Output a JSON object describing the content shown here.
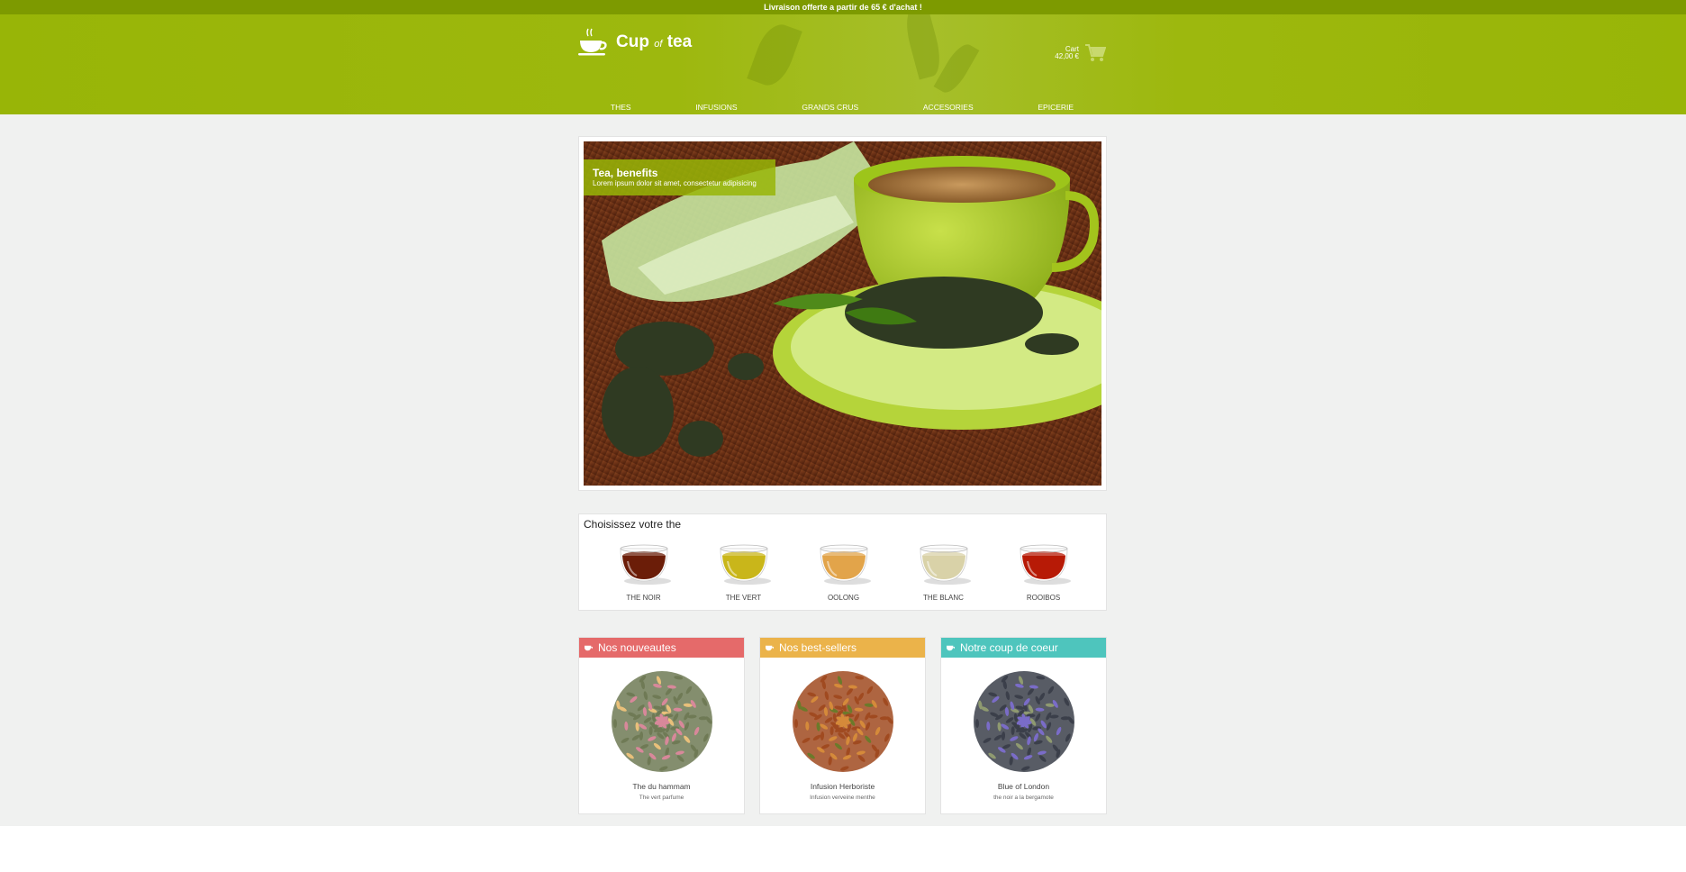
{
  "topbar": {
    "text": "Livraison offerte a partir de 65 € d'achat !"
  },
  "header": {
    "logo": {
      "text_cup": "Cup",
      "text_of": "of",
      "text_tea": "tea"
    },
    "cart": {
      "label": "Cart",
      "amount": "42,00 €"
    },
    "nav": [
      "THES",
      "INFUSIONS",
      "GRANDS CRUS",
      "ACCESORIES",
      "EPICERIE"
    ]
  },
  "hero": {
    "title": "Tea, benefits",
    "subtitle": "Lorem ipsum dolor sit amet, consectetur adipisicing"
  },
  "choose": {
    "title": "Choisissez votre the",
    "teas": [
      {
        "label": "THE NOIR",
        "color": "#6b1d08"
      },
      {
        "label": "THE VERT",
        "color": "#c9b61a"
      },
      {
        "label": "OOLONG",
        "color": "#e2a44a"
      },
      {
        "label": "THE BLANC",
        "color": "#d9d2a8"
      },
      {
        "label": "ROOIBOS",
        "color": "#b71a06"
      }
    ]
  },
  "cards": [
    {
      "header": "Nos nouveautes",
      "color": "#e56a6a",
      "name": "The du hammam",
      "desc": "The vert parfume"
    },
    {
      "header": "Nos best-sellers",
      "color": "#ebb34a",
      "name": "Infusion Herboriste",
      "desc": "Infusion verveine menthe"
    },
    {
      "header": "Notre coup de coeur",
      "color": "#4ec5bd",
      "name": "Blue of London",
      "desc": "the noir a la bergamote"
    }
  ],
  "colors": {
    "brand": "#98b507",
    "topbar": "#7d9a00",
    "background": "#f0f1f0"
  }
}
